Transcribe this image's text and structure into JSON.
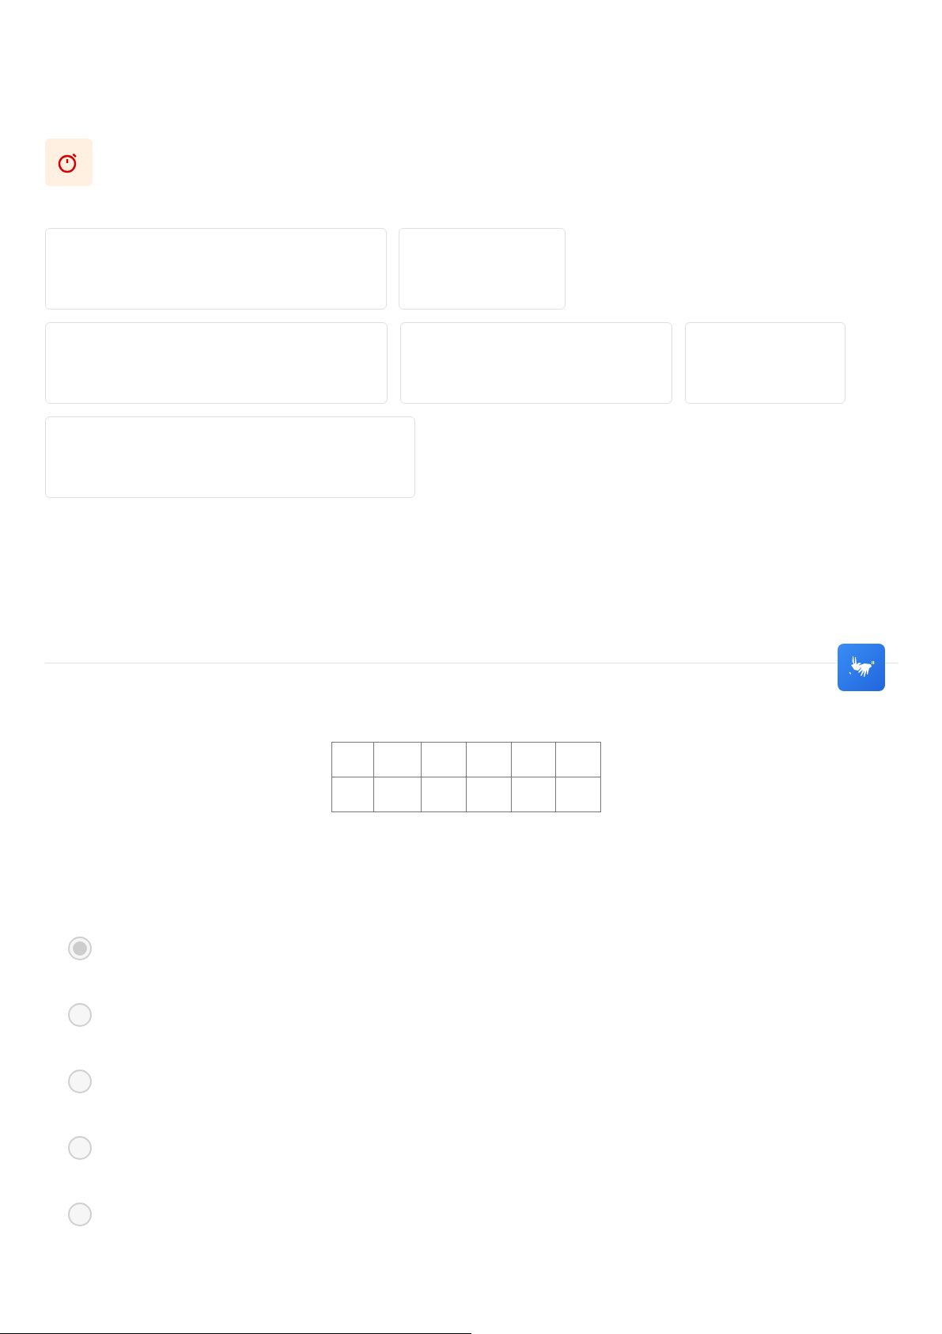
{
  "radio_options": [
    {
      "selected": true
    },
    {
      "selected": false
    },
    {
      "selected": false
    },
    {
      "selected": false
    },
    {
      "selected": false
    }
  ]
}
